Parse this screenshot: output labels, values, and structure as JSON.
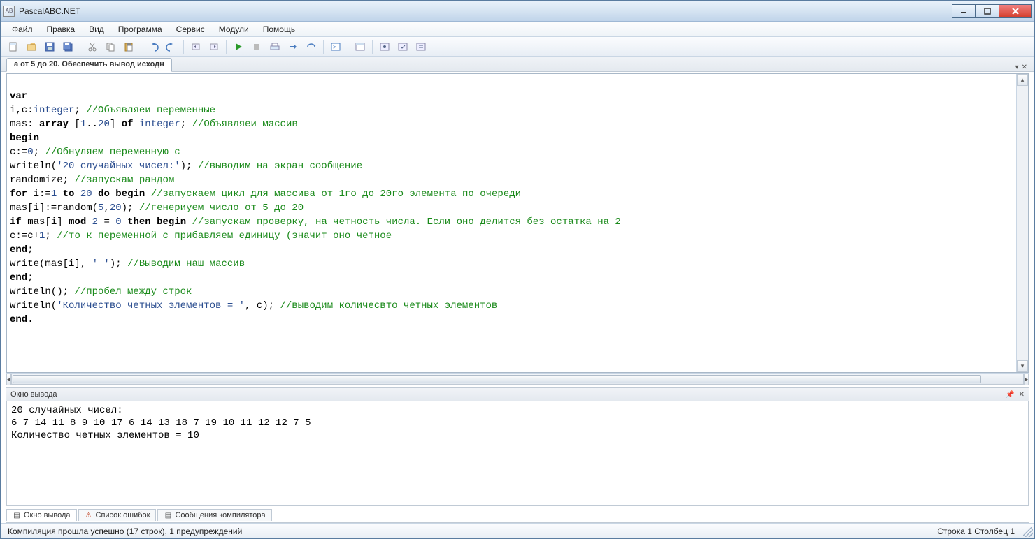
{
  "window": {
    "title": "PascalABC.NET"
  },
  "menu": {
    "file": "Файл",
    "edit": "Правка",
    "view": "Вид",
    "program": "Программа",
    "service": "Сервис",
    "modules": "Модули",
    "help": "Помощь"
  },
  "tab": {
    "label": "а от 5 до 20. Обеспечить вывод исходн"
  },
  "code": {
    "l1_kw": "var",
    "l2a": "i,c:",
    "l2_type": "integer",
    "l2b": "; ",
    "l2_cm": "//Объявляеи переменные",
    "l3a": "mas: ",
    "l3_kw1": "array",
    "l3b": " [",
    "l3_n1": "1",
    "l3c": "..",
    "l3_n2": "20",
    "l3d": "] ",
    "l3_kw2": "of",
    "l3e": " ",
    "l3_type": "integer",
    "l3f": "; ",
    "l3_cm": "//Объявляеи массив",
    "l4_kw": "begin",
    "l5a": "c:=",
    "l5_n": "0",
    "l5b": "; ",
    "l5_cm": "//Обнуляем переменную с",
    "l6a": "writeln(",
    "l6_s": "'20 случайных чисел:'",
    "l6b": "); ",
    "l6_cm": "//выводим на экран сообщение",
    "l7a": "randomize; ",
    "l7_cm": "//запускам рандом",
    "l8_kw1": "for",
    "l8a": " i:=",
    "l8_n1": "1",
    "l8b": " ",
    "l8_kw2": "to",
    "l8c": " ",
    "l8_n2": "20",
    "l8d": " ",
    "l8_kw3": "do",
    "l8e": " ",
    "l8_kw4": "begin",
    "l8f": " ",
    "l8_cm": "//запускаем цикл для массива от 1го до 20го элемента по очереди",
    "l9a": "mas[i]:=random(",
    "l9_n1": "5",
    "l9b": ",",
    "l9_n2": "20",
    "l9c": "); ",
    "l9_cm": "//генериуем число от 5 до 20",
    "l10_kw1": "if",
    "l10a": " mas[i] ",
    "l10_kw2": "mod",
    "l10b": " ",
    "l10_n1": "2",
    "l10c": " = ",
    "l10_n2": "0",
    "l10d": " ",
    "l10_kw3": "then",
    "l10e": " ",
    "l10_kw4": "begin",
    "l10f": " ",
    "l10_cm": "//запускам проверку, на четность числа. Если оно делится без остатка на 2",
    "l11a": "c:=c+",
    "l11_n": "1",
    "l11b": "; ",
    "l11_cm": "//то к переменной с прибавляем единицу (значит оно четное",
    "l12_kw": "end",
    "l12a": ";",
    "l13a": "write(mas[i], ",
    "l13_s": "' '",
    "l13b": "); ",
    "l13_cm": "//Выводим наш массив",
    "l14_kw": "end",
    "l14a": ";",
    "l15a": "writeln(); ",
    "l15_cm": "//пробел между строк",
    "l16a": "writeln(",
    "l16_s": "'Количество четных элементов = '",
    "l16b": ", c); ",
    "l16_cm": "//выводим количесвто четных элементов",
    "l17_kw": "end",
    "l17a": "."
  },
  "output_panel": {
    "title": "Окно вывода",
    "line1": "20 случайных чисел:",
    "line2": "6 7 14 11 8 9 10 17 6 14 13 18 7 19 10 11 12 12 7 5",
    "line3": "Количество четных элементов = 10"
  },
  "bottom_tabs": {
    "t1": "Окно вывода",
    "t2": "Список ошибок",
    "t3": "Сообщения компилятора"
  },
  "status": {
    "left": "Компиляция прошла успешно (17 строк), 1 предупреждений",
    "right": "Строка 1  Столбец 1"
  }
}
